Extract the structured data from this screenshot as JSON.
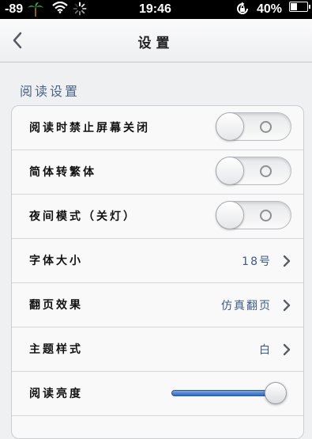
{
  "status_bar": {
    "signal": "-89",
    "time": "19:46",
    "battery": "40%",
    "icons": [
      "palm-tree-icon",
      "wifi-icon",
      "loading-spinner-icon",
      "rotation-lock-icon",
      "battery-icon"
    ]
  },
  "nav": {
    "title": "设置",
    "back_icon": "chevron-left-icon"
  },
  "section": {
    "title": "阅读设置"
  },
  "rows": [
    {
      "label": "阅读时禁止屏幕关闭",
      "type": "toggle",
      "on": false
    },
    {
      "label": "简体转繁体",
      "type": "toggle",
      "on": false
    },
    {
      "label": "夜间模式（关灯）",
      "type": "toggle",
      "on": false
    },
    {
      "label": "字体大小",
      "type": "disclosure",
      "value": "18号"
    },
    {
      "label": "翻页效果",
      "type": "disclosure",
      "value": "仿真翻页"
    },
    {
      "label": "主题样式",
      "type": "disclosure",
      "value": "白"
    },
    {
      "label": "阅读亮度",
      "type": "slider",
      "level": 0.92
    }
  ],
  "colors": {
    "accent_text": "#3f5a83",
    "slider_fill": "#2f66c4",
    "background": "#eff0f2"
  }
}
